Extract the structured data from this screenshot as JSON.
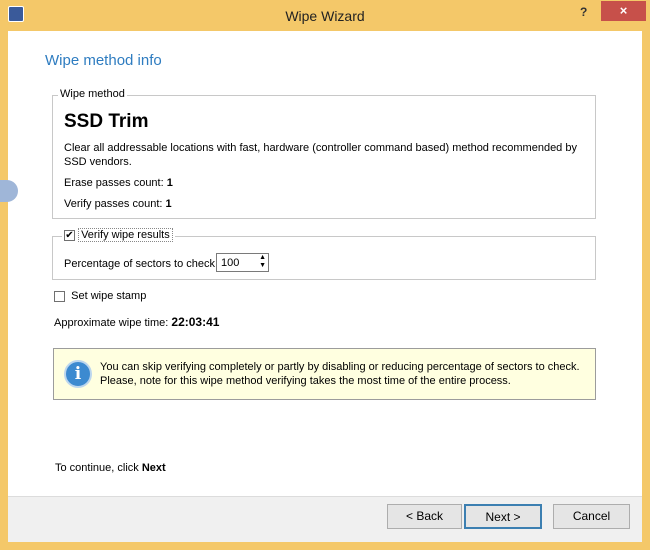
{
  "window": {
    "title": "Wipe Wizard",
    "help": "?",
    "close": "×"
  },
  "heading": "Wipe method info",
  "wipe_method": {
    "legend": "Wipe method",
    "name": "SSD Trim",
    "description": "Clear all addressable locations with fast, hardware (controller command based) method recommended by SSD vendors.",
    "erase_label": "Erase passes count:",
    "erase_value": "1",
    "verify_label": "Verify passes count:",
    "verify_value": "1"
  },
  "verify": {
    "label": "Verify wipe results",
    "checked": true,
    "pct_label": "Percentage of sectors to check:",
    "pct_value": "100"
  },
  "stamp": {
    "label": "Set wipe stamp",
    "checked": false
  },
  "time": {
    "label": "Approximate wipe time:",
    "value": "22:03:41"
  },
  "info": "You can skip verifying completely or partly by disabling or reducing percentage of sectors to check. Please, note for this wipe method verifying takes the most time of the entire process.",
  "continue": {
    "text": "To continue, click",
    "bold": "Next"
  },
  "buttons": {
    "back": "< Back",
    "next": "Next >",
    "cancel": "Cancel"
  }
}
